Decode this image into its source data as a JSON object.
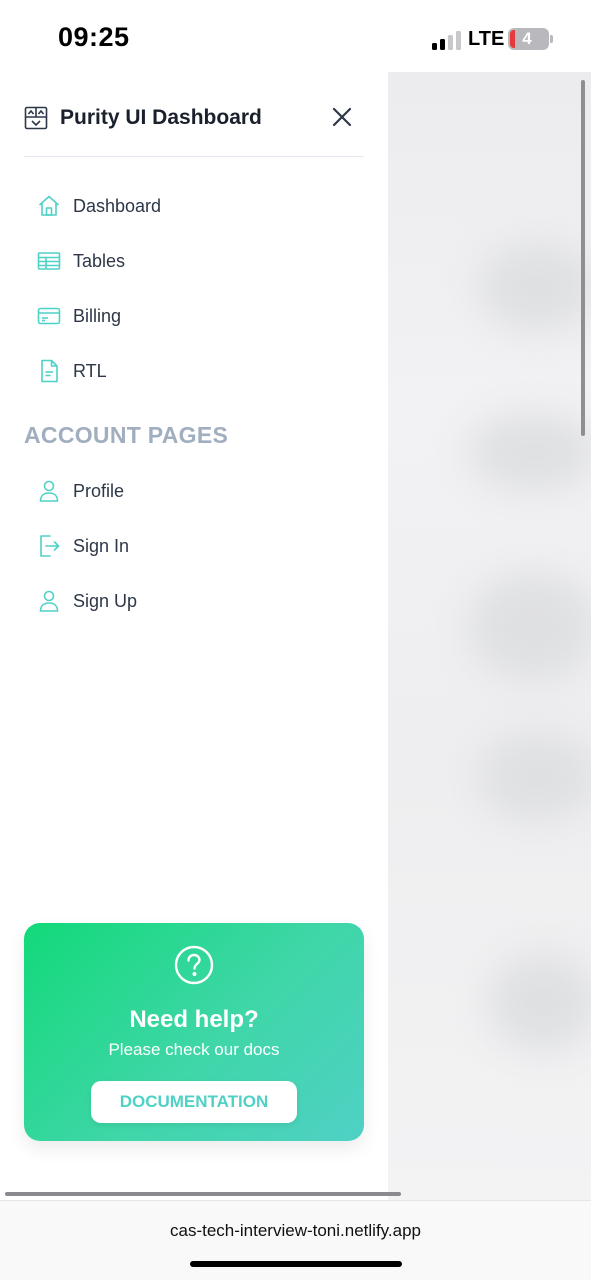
{
  "status_bar": {
    "time": "09:25",
    "network": "LTE",
    "battery": "4"
  },
  "sidebar": {
    "brand": "Purity UI Dashboard",
    "items": [
      {
        "label": "Dashboard",
        "icon": "home-icon"
      },
      {
        "label": "Tables",
        "icon": "table-icon"
      },
      {
        "label": "Billing",
        "icon": "credit-card-icon"
      },
      {
        "label": "RTL",
        "icon": "document-icon"
      }
    ],
    "account_section_title": "ACCOUNT PAGES",
    "account_items": [
      {
        "label": "Profile",
        "icon": "person-icon"
      },
      {
        "label": "Sign In",
        "icon": "sign-in-icon"
      },
      {
        "label": "Sign Up",
        "icon": "person-icon"
      }
    ]
  },
  "help_card": {
    "title": "Need help?",
    "subtitle": "Please check our docs",
    "button_label": "DOCUMENTATION"
  },
  "browser": {
    "url": "cas-tech-interview-toni.netlify.app"
  },
  "colors": {
    "accent": "#4fd1c5",
    "section_title": "#a0aec0",
    "card_gradient_start": "#12d979",
    "card_gradient_end": "#4fd1c5"
  }
}
